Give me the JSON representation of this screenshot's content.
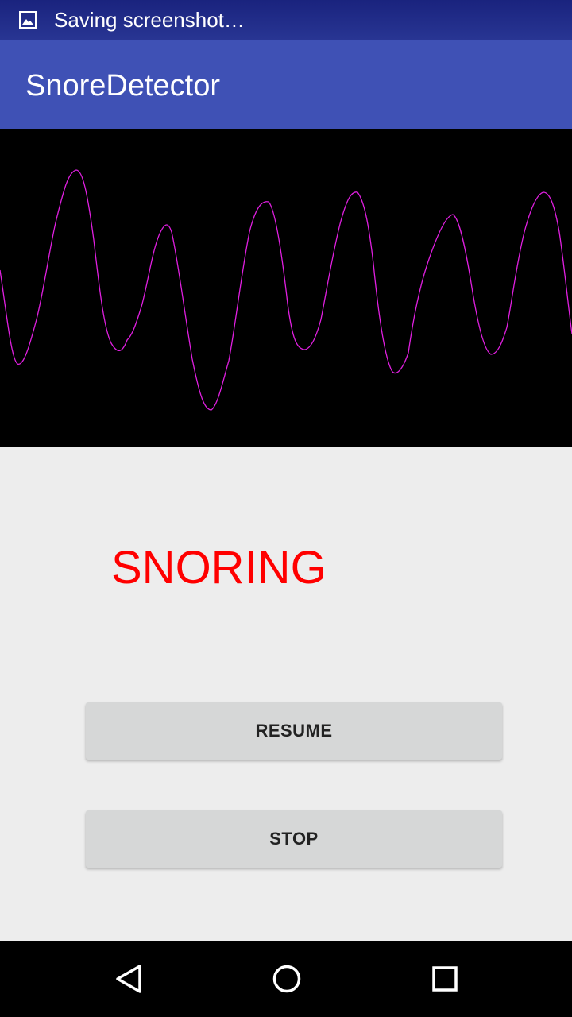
{
  "status_bar": {
    "notification_icon": "image-icon",
    "text": "Saving screenshot…"
  },
  "app_bar": {
    "title": "SnoreDetector",
    "color": "#3f51b5"
  },
  "waveform": {
    "background": "#000000",
    "line_color": "#e01fe0"
  },
  "detection": {
    "status_text": "SNORING",
    "status_color": "#ff0000"
  },
  "buttons": {
    "resume_label": "RESUME",
    "stop_label": "STOP"
  },
  "nav_bar": {
    "back_icon": "back-triangle-icon",
    "home_icon": "home-circle-icon",
    "recents_icon": "recents-square-icon"
  }
}
